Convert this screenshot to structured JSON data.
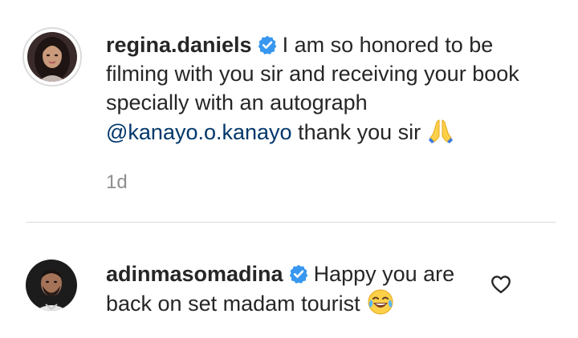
{
  "comments": [
    {
      "username": "regina.daniels",
      "text_part1": "I am so honored to be filming with you sir and receiving your book specially with an autograph",
      "mention": "@kanayo.o.kanayo",
      "text_part2": "thank you sir",
      "emoji": "folded-hands-emoji",
      "time": "1d"
    },
    {
      "username": "adinmasomadina",
      "text": "Happy you are back on set madam tourist",
      "emoji": "tears-of-joy-emoji"
    }
  ],
  "colors": {
    "text": "#262626",
    "mention": "#00376b",
    "muted": "#8e8e8e",
    "verified": "#3897f0",
    "divider": "#dbdbdb"
  },
  "icons": [
    "verified-badge-icon",
    "heart-outline-icon"
  ]
}
